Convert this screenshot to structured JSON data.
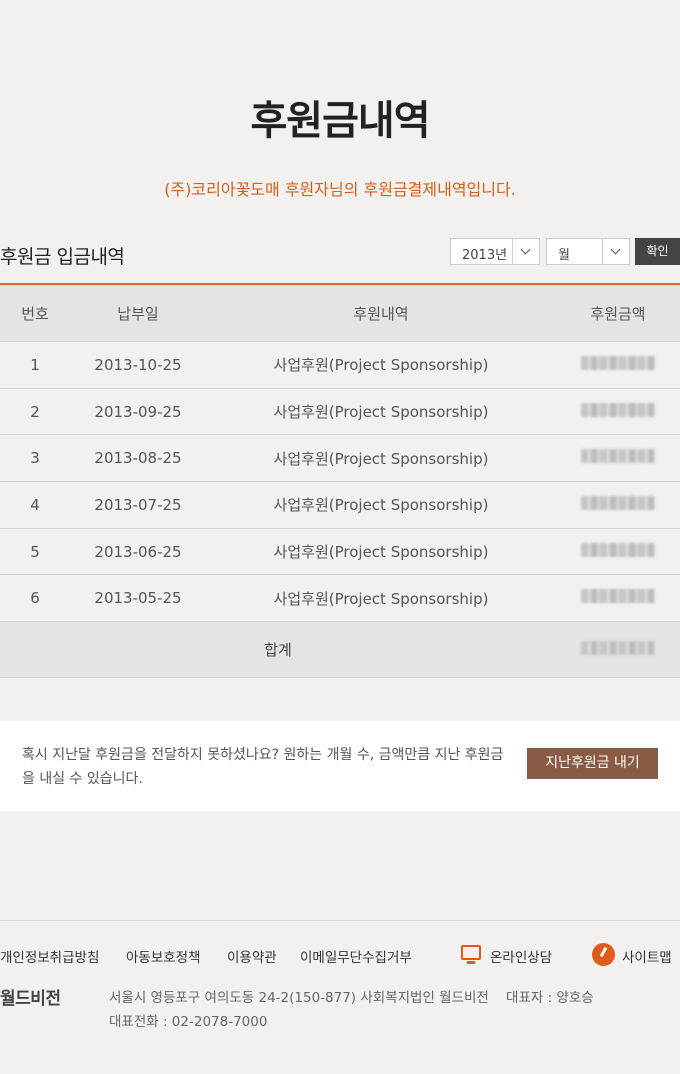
{
  "header": {
    "title": "후원금내역",
    "subtitle": "(주)코리아꽃도매 후원자님의 후원금결제내역입니다."
  },
  "filter": {
    "section_title": "후원금 입금내역",
    "year_value": "2013년",
    "month_value": "월",
    "confirm_label": "확인"
  },
  "table": {
    "headers": [
      "번호",
      "납부일",
      "후원내역",
      "후원금액"
    ],
    "rows": [
      {
        "no": "1",
        "date": "2013-10-25",
        "desc": "사업후원(Project Sponsorship)"
      },
      {
        "no": "2",
        "date": "2013-09-25",
        "desc": "사업후원(Project Sponsorship)"
      },
      {
        "no": "3",
        "date": "2013-08-25",
        "desc": "사업후원(Project Sponsorship)"
      },
      {
        "no": "4",
        "date": "2013-07-25",
        "desc": "사업후원(Project Sponsorship)"
      },
      {
        "no": "5",
        "date": "2013-06-25",
        "desc": "사업후원(Project Sponsorship)"
      },
      {
        "no": "6",
        "date": "2013-05-25",
        "desc": "사업후원(Project Sponsorship)"
      }
    ],
    "total_label": "합계"
  },
  "notice": {
    "text": "혹시 지난달 후원금을 전달하지 못하셨나요? 원하는 개월 수, 금액만큼 지난 후원금을 내실 수 있습니다.",
    "button_label": "지난후원금 내기"
  },
  "footer": {
    "links": [
      "개인정보취급방침",
      "아동보호정책",
      "이용약관",
      "이메일무단수집거부"
    ],
    "online_consult": "온라인상담",
    "sitemap": "사이트맵",
    "logo": "월드비전",
    "address": "서울시 영등포구 여의도동 24-2(150-877) 사회복지법인 월드비전",
    "ceo": "대표자 : 양호승",
    "phone": "대표전화 : 02-2078-7000"
  },
  "colors": {
    "accent": "#d96b2b",
    "button_brown": "#8a5a44",
    "dark_button": "#444444"
  }
}
